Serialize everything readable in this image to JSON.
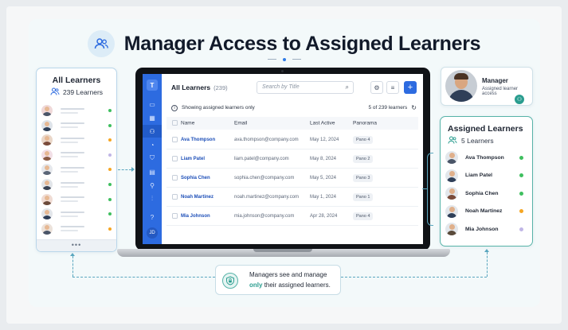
{
  "title": "Manager Access to Assigned Learners",
  "all_learners": {
    "title": "All Learners",
    "count": "239 Learners",
    "more": "•••",
    "rows": [
      {
        "dot": "#3fbf5f"
      },
      {
        "dot": "#3fbf5f"
      },
      {
        "dot": "#f5a623"
      },
      {
        "dot": "#c0b6e6"
      },
      {
        "dot": "#f5a623"
      },
      {
        "dot": "#3fbf5f"
      },
      {
        "dot": "#3fbf5f"
      },
      {
        "dot": "#3fbf5f"
      },
      {
        "dot": "#f5a623"
      }
    ]
  },
  "app": {
    "logo": "T",
    "header_title": "All Learners",
    "header_count": "(239)",
    "search_placeholder": "Search by Title",
    "info_text": "Showing assigned learners only",
    "count_text": "5 of 239 learners",
    "avatar_initials": "JD",
    "columns": [
      "Name",
      "Email",
      "Last Active",
      "Panorama"
    ],
    "rows": [
      {
        "name": "Ava Thompson",
        "email": "ava.thompson@company.com",
        "date": "May 12, 2024",
        "pano": "Pano 4"
      },
      {
        "name": "Liam Patel",
        "email": "liam.patel@company.com",
        "date": "May 8, 2024",
        "pano": "Pano 2"
      },
      {
        "name": "Sophia Chen",
        "email": "sophia.chen@company.com",
        "date": "May 5, 2024",
        "pano": "Pano 3"
      },
      {
        "name": "Noah Martinez",
        "email": "noah.martinez@company.com",
        "date": "May 1, 2024",
        "pano": "Pano 1"
      },
      {
        "name": "Mia Johnson",
        "email": "mia.johnson@company.com",
        "date": "Apr 28, 2024",
        "pano": "Pano 4"
      }
    ]
  },
  "manager": {
    "name": "Manager",
    "role": "Assigned learner access"
  },
  "assigned": {
    "title": "Assigned Learners",
    "count": "5 Learners",
    "rows": [
      {
        "name": "Ava Thompson",
        "dot": "#3fbf5f"
      },
      {
        "name": "Liam Patel",
        "dot": "#3fbf5f"
      },
      {
        "name": "Sophia Chen",
        "dot": "#3fbf5f"
      },
      {
        "name": "Noah Martinez",
        "dot": "#f5a623"
      },
      {
        "name": "Mia Johnson",
        "dot": "#c0b6e6"
      }
    ]
  },
  "callout": {
    "line1": "Managers see and manage",
    "highlight": "only",
    "line2_rest": "their assigned learners."
  },
  "icons": [
    "users-icon",
    "search-icon",
    "gear-icon",
    "filter-icon",
    "plus-icon",
    "info-icon",
    "refresh-icon",
    "lock-shield-icon"
  ],
  "colors": {
    "accent_blue": "#2d6be0",
    "teal": "#2a9d8f",
    "green": "#3fbf5f",
    "orange": "#f5a623",
    "lavender": "#c0b6e6"
  }
}
